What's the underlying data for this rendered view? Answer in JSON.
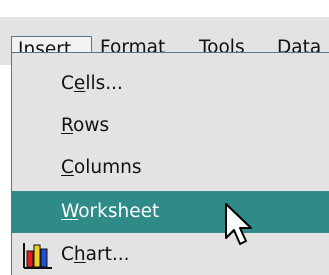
{
  "menubar": {
    "items": [
      {
        "label": "Insert",
        "mnemonic": "I",
        "active": true
      },
      {
        "label": "Format",
        "mnemonic": "o",
        "active": false
      },
      {
        "label": "Tools",
        "mnemonic": "T",
        "active": false
      },
      {
        "label": "Data",
        "mnemonic": "D",
        "active": false
      }
    ]
  },
  "insert_menu": {
    "items": [
      {
        "label": "Cells...",
        "mnemonic": "e",
        "icon": null,
        "highlighted": false
      },
      {
        "label": "Rows",
        "mnemonic": "R",
        "icon": null,
        "highlighted": false
      },
      {
        "label": "Columns",
        "mnemonic": "C",
        "icon": null,
        "highlighted": false
      },
      {
        "label": "Worksheet",
        "mnemonic": "W",
        "icon": null,
        "highlighted": true
      },
      {
        "label": "Chart...",
        "mnemonic": "h",
        "icon": "bar-chart-icon",
        "highlighted": false
      }
    ]
  },
  "colors": {
    "menu_background": "#e3e3e3",
    "highlight": "#2e8b87",
    "border": "#5a7396",
    "text": "#111111"
  },
  "pointer": {
    "icon": "mouse-pointer-icon"
  }
}
